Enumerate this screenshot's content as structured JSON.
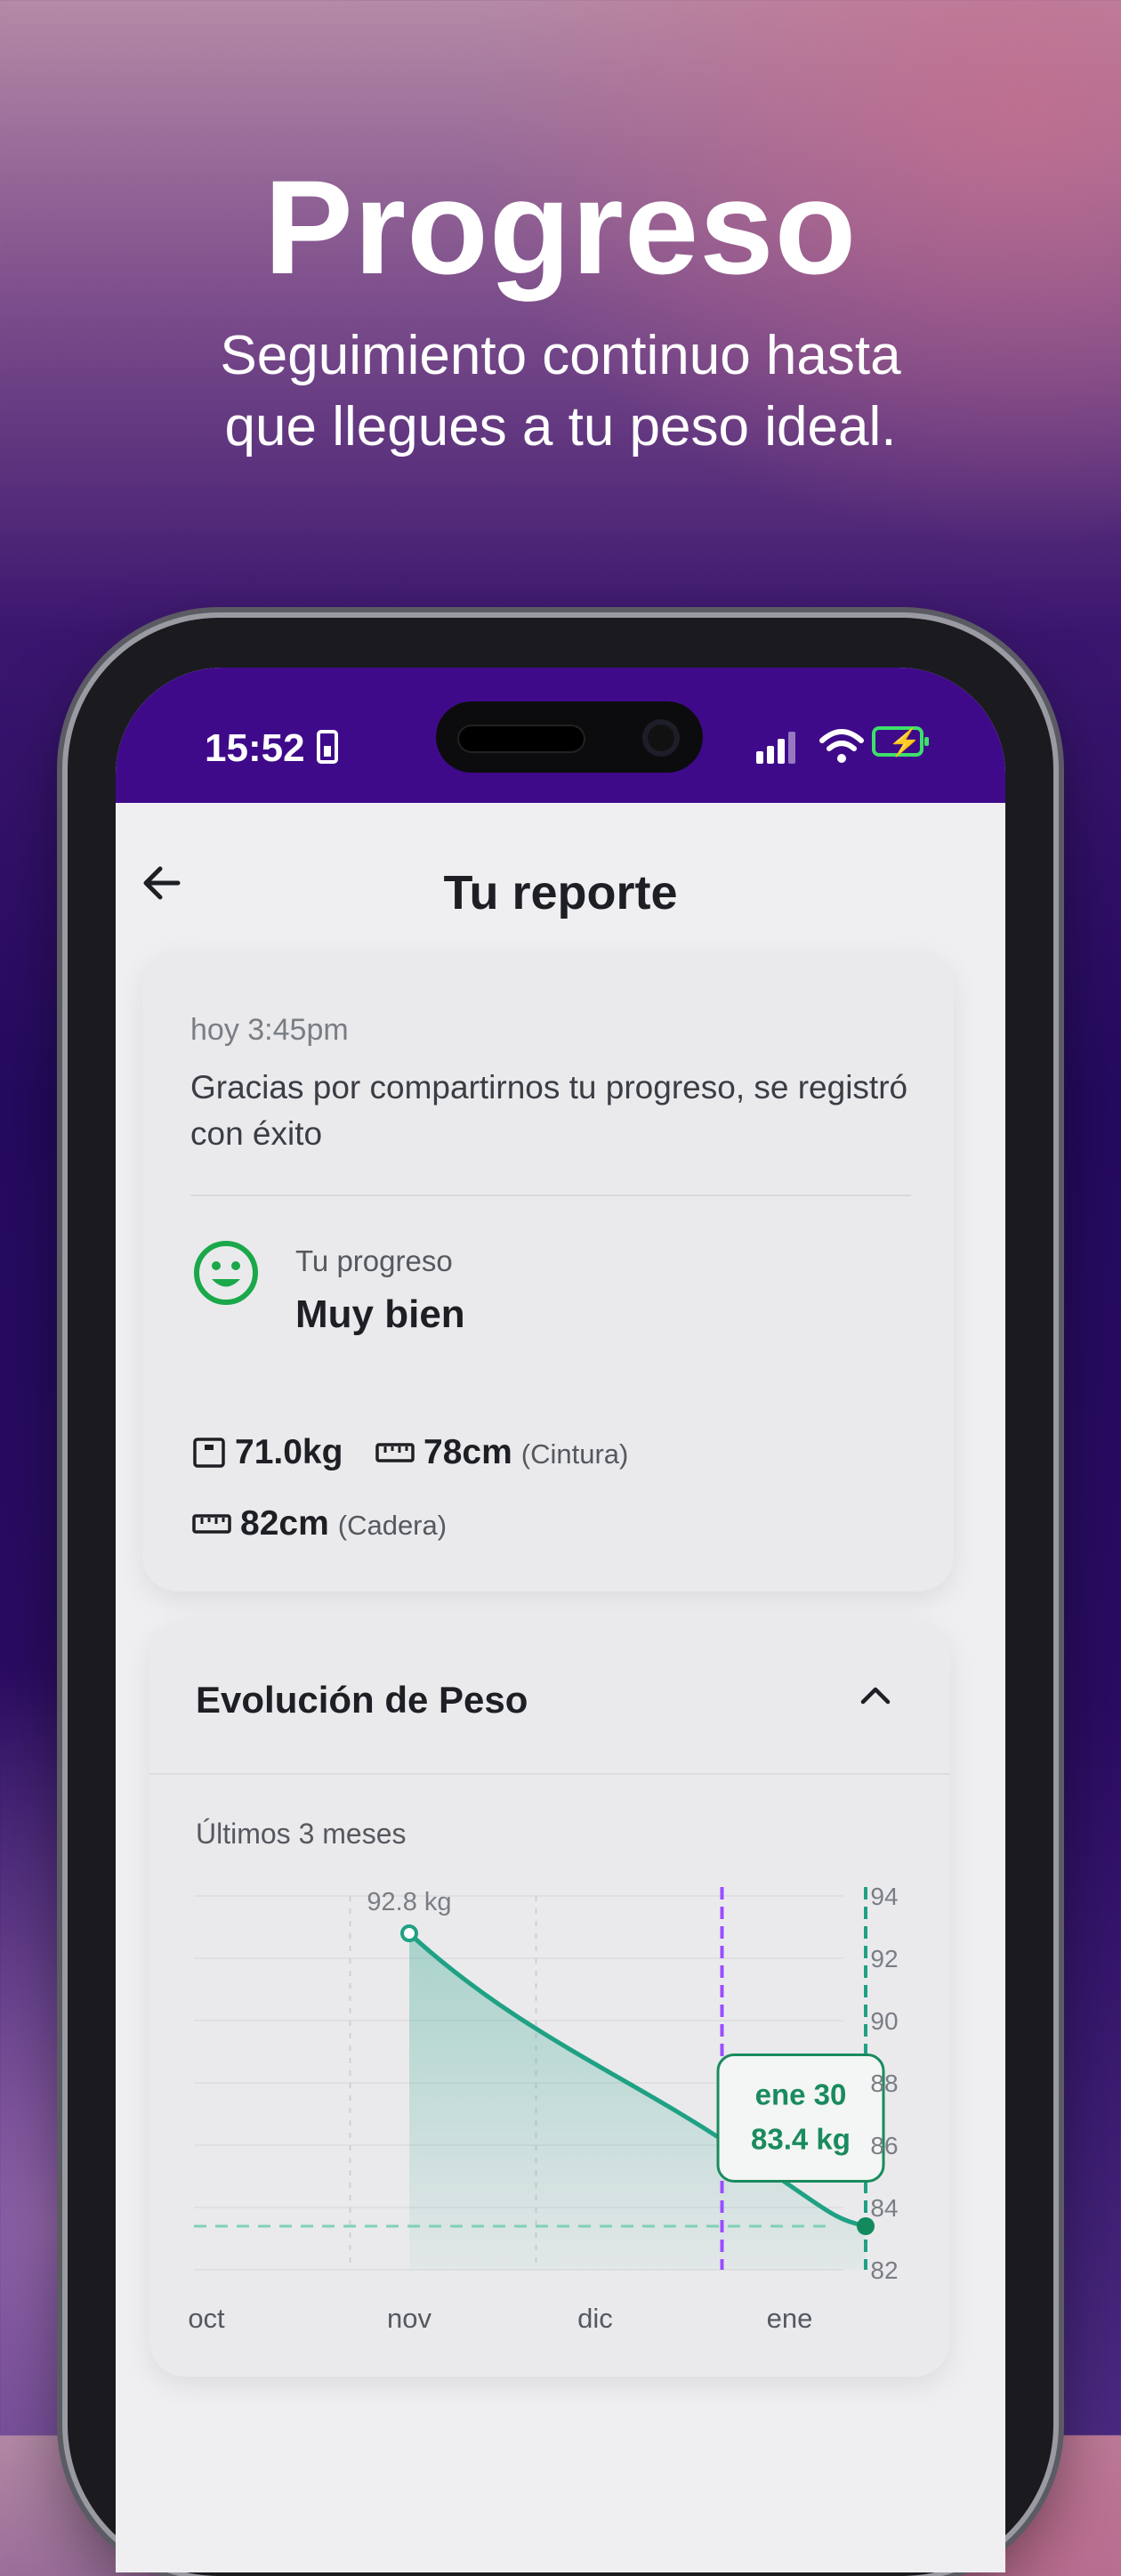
{
  "hero": {
    "title": "Progreso",
    "subtitle_line1": "Seguimiento continuo hasta",
    "subtitle_line2": "que llegues a tu peso ideal."
  },
  "status_bar": {
    "time": "15:52",
    "battery_color": "#3de06a",
    "bar_color": "#3f0a8a"
  },
  "header": {
    "title": "Tu reporte",
    "back_icon": "arrow-left-icon"
  },
  "report": {
    "timestamp": "hoy 3:45pm",
    "message": "Gracias por compartirnos tu progreso, se registró con éxito",
    "progress_label": "Tu progreso",
    "progress_value": "Muy bien",
    "progress_icon": "smiley-face-icon",
    "progress_color": "#1aa84a",
    "metrics": [
      {
        "icon": "scale-icon",
        "value": "71.0kg",
        "qualifier": ""
      },
      {
        "icon": "ruler-icon",
        "value": "78cm",
        "qualifier": "(Cintura)"
      },
      {
        "icon": "ruler-icon",
        "value": "82cm",
        "qualifier": "(Cadera)"
      }
    ]
  },
  "chart_section": {
    "title": "Evolución de Peso",
    "toggle_icon": "chevron-up-icon",
    "range_label": "Últimos 3 meses"
  },
  "chart_data": {
    "type": "area",
    "categories": [
      "oct",
      "nov",
      "dic",
      "ene"
    ],
    "y_ticks": [
      "94",
      "92",
      "90",
      "88",
      "86",
      "84",
      "82"
    ],
    "ylim": [
      82,
      94
    ],
    "series": [
      {
        "points": [
          [
            0.8,
            92.8
          ],
          [
            2.7,
            86.0
          ],
          [
            3.5,
            83.4
          ]
        ]
      }
    ],
    "start_label": "92.8 kg",
    "reference_line": 83.4,
    "tooltip": {
      "date": "ene 30",
      "value": "83.4 kg"
    },
    "line_color": "#1fa184",
    "marker_line_color": "#9b4dff",
    "grid": true
  }
}
